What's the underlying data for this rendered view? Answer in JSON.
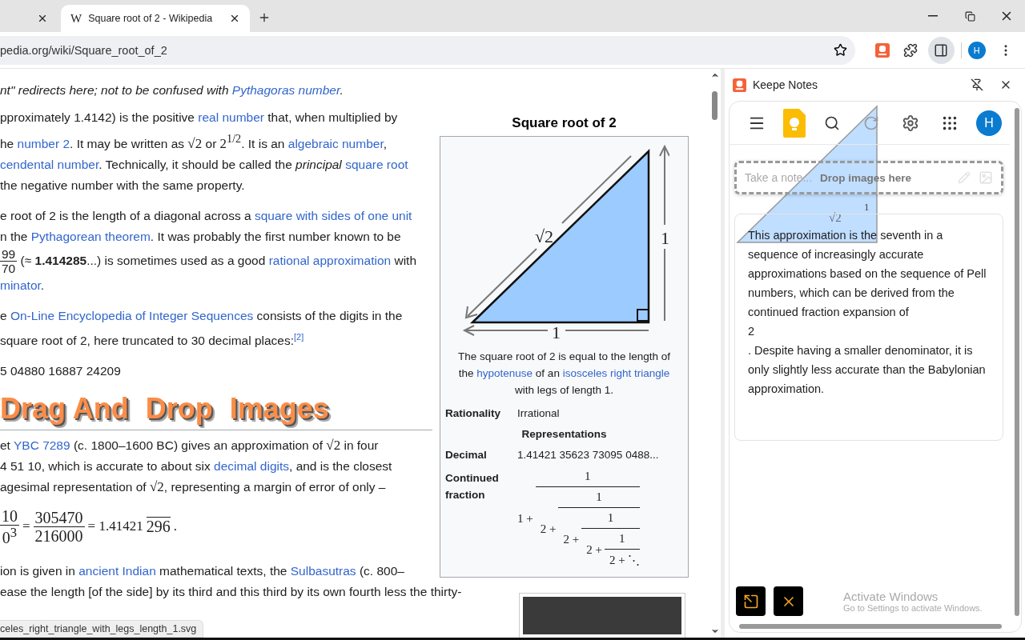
{
  "browser": {
    "tabs": [
      {
        "selected": false
      },
      {
        "favicon": "W",
        "title": "Square root of 2 - Wikipedia",
        "selected": true
      }
    ],
    "address": "pedia.org/wiki/Square_root_of_2",
    "toolbar": {
      "avatar": "H",
      "side_panel_open": true
    }
  },
  "article": {
    "hatnote": [
      {
        "kind": "text",
        "text": "nt\" redirects here; not to be confused with "
      },
      {
        "kind": "link",
        "text": "Pythagoras number"
      },
      {
        "kind": "text",
        "text": "."
      }
    ],
    "blocks": [
      {
        "kind": "paragraph",
        "lines": [
          [
            {
              "kind": "text",
              "text": "pproximately 1.4142) is the positive "
            },
            {
              "kind": "link",
              "text": "real number"
            },
            {
              "kind": "text",
              "text": " that, when multiplied by"
            }
          ],
          [
            {
              "kind": "text",
              "text": "he "
            },
            {
              "kind": "link",
              "text": "number 2"
            },
            {
              "kind": "text",
              "text": ". It may be written as "
            },
            {
              "kind": "math",
              "text": "√2"
            },
            {
              "kind": "text",
              "text": " or "
            },
            {
              "kind": "math",
              "text": "2$^{1/2}$"
            },
            {
              "kind": "text",
              "text": ". It is an "
            },
            {
              "kind": "link",
              "text": "algebraic number"
            },
            {
              "kind": "text",
              "text": ","
            }
          ],
          [
            {
              "kind": "link",
              "text": "cendental number"
            },
            {
              "kind": "text",
              "text": ". Technically, it should be called the "
            },
            {
              "kind": "italic",
              "text": "principal"
            },
            {
              "kind": "link",
              "text": "square root"
            }
          ],
          [
            {
              "kind": "text",
              "text": " the negative number with the same property."
            }
          ]
        ]
      },
      {
        "kind": "paragraph",
        "lines": [
          [
            {
              "kind": "text",
              "text": "e root of 2 is the length of a diagonal across a "
            },
            {
              "kind": "link",
              "text": "square with sides of one unit"
            }
          ],
          [
            {
              "kind": "text",
              "text": "n the "
            },
            {
              "kind": "link",
              "text": "Pythagorean theorem"
            },
            {
              "kind": "text",
              "text": ". It was probably the first number known to be"
            }
          ],
          [
            {
              "kind": "frac",
              "num": "99",
              "den": "70"
            },
            {
              "kind": "text",
              "text": " (≈ "
            },
            {
              "kind": "bold",
              "text": "1.414285"
            },
            {
              "kind": "text",
              "text": "...) is sometimes used as a good "
            },
            {
              "kind": "link",
              "text": "rational approximation"
            },
            {
              "kind": "text",
              "text": " with"
            }
          ],
          [
            {
              "kind": "link",
              "text": "minator"
            },
            {
              "kind": "text",
              "text": "."
            }
          ]
        ]
      },
      {
        "kind": "paragraph",
        "lines": [
          [
            {
              "kind": "text",
              "text": "e "
            },
            {
              "kind": "link",
              "text": "On-Line Encyclopedia of Integer Sequences"
            },
            {
              "kind": "text",
              "text": " consists of the digits in the"
            }
          ],
          [
            {
              "kind": "text",
              "text": " square root of 2, here truncated to 30 decimal places:"
            },
            {
              "kind": "sup_link",
              "text": "[2]"
            }
          ]
        ]
      },
      {
        "kind": "paragraph",
        "lines": [
          [
            {
              "kind": "text",
              "text": "5 04880 16887 24209"
            }
          ]
        ]
      },
      {
        "kind": "promo",
        "lines": [
          "Drag And",
          "Drop",
          "Images"
        ]
      },
      {
        "kind": "rule"
      },
      {
        "kind": "paragraph",
        "lines": [
          [
            {
              "kind": "text",
              "text": "et "
            },
            {
              "kind": "link",
              "text": "YBC 7289"
            },
            {
              "kind": "text",
              "text": " (c. 1800–1600 BC) gives an approximation of "
            },
            {
              "kind": "math",
              "text": "√2"
            },
            {
              "kind": "text",
              "text": " in four"
            }
          ],
          [
            {
              "kind": "text",
              "text": "4 51 10, which is accurate to about six "
            },
            {
              "kind": "link",
              "text": "decimal digits"
            },
            {
              "kind": "text",
              "text": ", and is the closest"
            }
          ],
          [
            {
              "kind": "text",
              "text": "agesimal representation of "
            },
            {
              "kind": "math",
              "text": "√2"
            },
            {
              "kind": "text",
              "text": ", representing a margin of error of only –"
            }
          ]
        ]
      },
      {
        "kind": "equation",
        "segments": [
          {
            "kind": "frac",
            "num": "10",
            "den": "0$^{3}$"
          },
          {
            "kind": "math",
            "text": " = "
          },
          {
            "kind": "frac",
            "num": "305470",
            "den": "216000"
          },
          {
            "kind": "math",
            "text": " = 1.41421"
          },
          {
            "kind": "overline",
            "text": "296"
          },
          {
            "kind": "math",
            "text": "."
          }
        ]
      },
      {
        "kind": "paragraph",
        "lines": [
          [
            {
              "kind": "text",
              "text": "ion is given in "
            },
            {
              "kind": "link",
              "text": "ancient Indian"
            },
            {
              "kind": "text",
              "text": " mathematical texts, the "
            },
            {
              "kind": "link",
              "text": "Sulbasutras"
            },
            {
              "kind": "text",
              "text": " (c. 800–"
            }
          ],
          [
            {
              "kind": "text",
              "text": "ease the length [of the side] by its third and this third by its own fourth less the thirty-"
            }
          ]
        ]
      }
    ]
  },
  "infobox": {
    "title": "Square root of 2",
    "diagram_labels": {
      "hypotenuse": "√2",
      "side": "1",
      "base": "1"
    },
    "caption": [
      {
        "kind": "text",
        "text": "The square root of 2 is equal to the length of the "
      },
      {
        "kind": "link",
        "text": "hypotenuse"
      },
      {
        "kind": "text",
        "text": " of an "
      },
      {
        "kind": "link",
        "text": "isosceles right triangle"
      },
      {
        "kind": "text",
        "text": " with legs of length 1."
      }
    ],
    "rows": [
      {
        "kind": "pair",
        "label": "Rationality",
        "value": "Irrational"
      },
      {
        "kind": "header",
        "label": "Representations"
      },
      {
        "kind": "pair",
        "label": "Decimal",
        "value": "1.41421 35623 73095 0488..."
      },
      {
        "kind": "fraction",
        "label": "Continued fraction",
        "whole": "1 +",
        "levels": [
          {
            "num": "1",
            "den": "2 +"
          },
          {
            "num": "1",
            "den": "2 +"
          },
          {
            "num": "1",
            "den": "2 +"
          },
          {
            "num": "1",
            "den": "2 +"
          }
        ],
        "ellipsis": "⋱"
      }
    ]
  },
  "status_bar": "celes_right_triangle_with_legs_length_1.svg",
  "side_panel": {
    "title": "Keepe Notes",
    "avatar": "H",
    "note_input": {
      "placeholder": "Take a note...",
      "drop_hint": "Drop images here"
    },
    "drag_ghost": {
      "hypotenuse": "√2",
      "side": "1"
    },
    "note": [
      "This approximation is the seventh in a sequence of increasingly accurate approximations based on the sequence of Pell numbers, which can be derived from the continued fraction expansion of",
      "2",
      ". Despite having a smaller denominator, it is only slightly less accurate than the Babylonian approximation."
    ],
    "os_notice": {
      "title": "Activate Windows",
      "subtitle": "Go to Settings to activate Windows."
    }
  }
}
